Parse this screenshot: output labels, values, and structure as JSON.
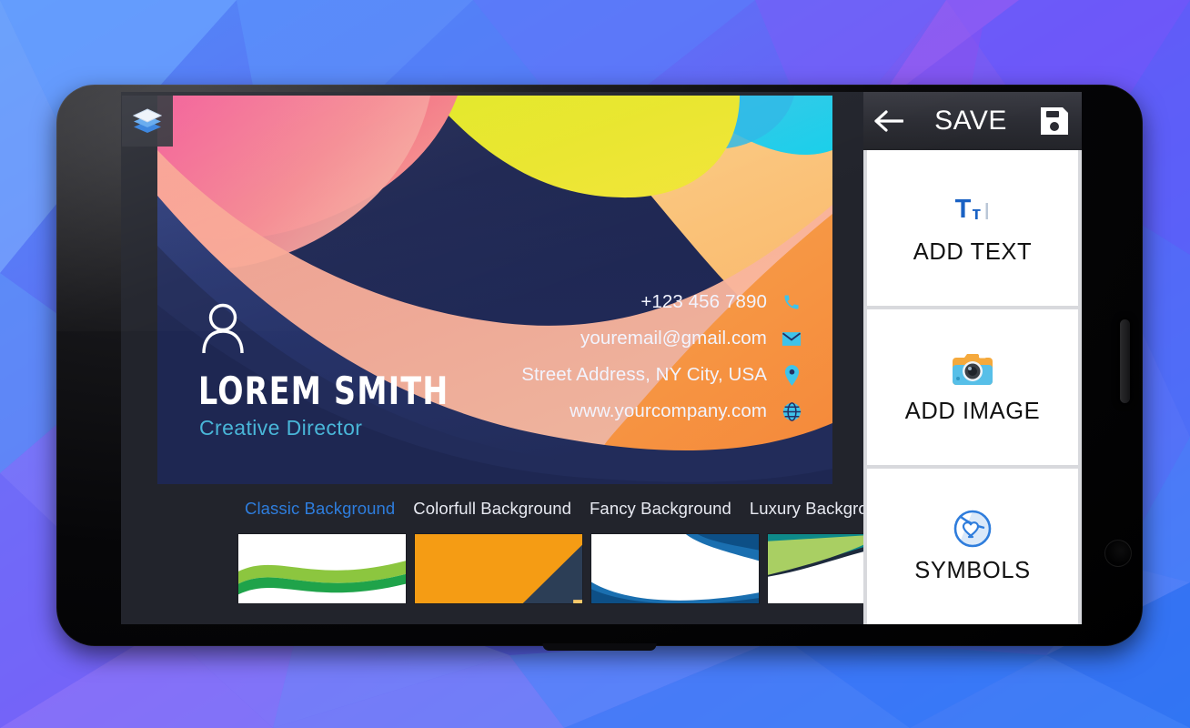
{
  "app": {
    "panel": {
      "save_label": "SAVE",
      "back_icon": "arrow-left-icon",
      "save_icon": "floppy-disk-icon",
      "items": [
        {
          "label": "ADD TEXT",
          "icon": "text-tool-icon"
        },
        {
          "label": "ADD IMAGE",
          "icon": "camera-icon"
        },
        {
          "label": "SYMBOLS",
          "icon": "sticker-heart-icon"
        }
      ]
    },
    "toolbar": {
      "layers_icon": "layers-icon",
      "fill_icon": "paint-bucket-icon",
      "camera_icon": "camera-icon"
    },
    "background_tabs": [
      {
        "label": "Classic Background",
        "active": true
      },
      {
        "label": "Colorfull Background",
        "active": false
      },
      {
        "label": "Fancy Background",
        "active": false
      },
      {
        "label": "Luxury Background",
        "active": false
      }
    ],
    "thumbnails": [
      {
        "name": "thumb-green-wave"
      },
      {
        "name": "thumb-orange-navy"
      },
      {
        "name": "thumb-blue-wave"
      },
      {
        "name": "thumb-green-teal-wave"
      }
    ],
    "card": {
      "name": "LOREM SMITH",
      "role": "Creative Director",
      "avatar_icon": "person-icon",
      "contacts": [
        {
          "text": "+123 456 7890",
          "icon": "phone-icon"
        },
        {
          "text": "youremail@gmail.com",
          "icon": "envelope-icon"
        },
        {
          "text": "Street Address, NY City, USA",
          "icon": "location-pin-icon"
        },
        {
          "text": "www.yourcompany.com",
          "icon": "globe-icon"
        }
      ]
    }
  },
  "colors": {
    "accent_blue": "#2e7ddd",
    "card_navy": "#253064",
    "role_cyan": "#49b6d8",
    "panel_bg": "#d8d9dd",
    "screen_dark": "#22242c"
  }
}
